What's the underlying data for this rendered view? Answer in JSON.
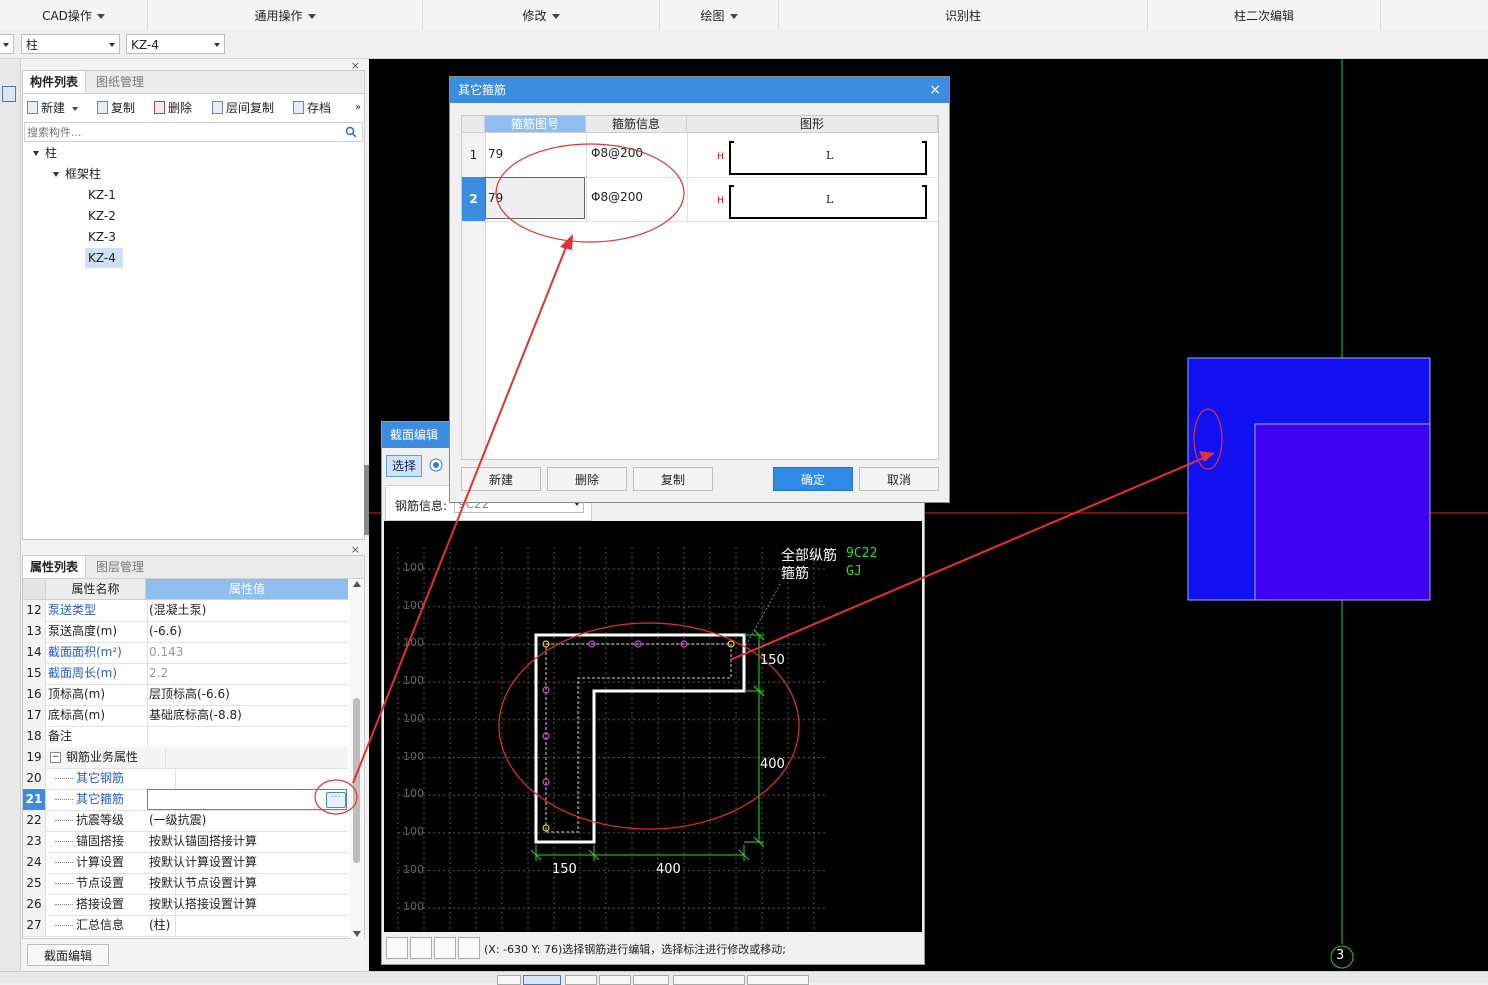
{
  "menu": {
    "items": [
      {
        "label": "CAD操作",
        "dropdown": true
      },
      {
        "label": "通用操作",
        "dropdown": true
      },
      {
        "label": "修改",
        "dropdown": true
      },
      {
        "label": "绘图",
        "dropdown": true
      },
      {
        "label": "识别柱",
        "dropdown": false
      },
      {
        "label": "柱二次编辑",
        "dropdown": false
      }
    ]
  },
  "filters": {
    "type": "柱",
    "component": "KZ-4"
  },
  "component_panel": {
    "tabs": [
      "构件列表",
      "图纸管理"
    ],
    "toolbar": [
      "新建",
      "复制",
      "删除",
      "层间复制",
      "存档"
    ],
    "search_placeholder": "搜索构件...",
    "tree": {
      "root": "柱",
      "group": "框架柱",
      "items": [
        "KZ-1",
        "KZ-2",
        "KZ-3",
        "KZ-4"
      ],
      "selected": "KZ-4"
    }
  },
  "property_panel": {
    "tabs": [
      "属性列表",
      "图层管理"
    ],
    "headers": {
      "name": "属性名称",
      "value": "属性值"
    },
    "rows": [
      {
        "num": "12",
        "name": "泵送类型",
        "value": "(混凝土泵)"
      },
      {
        "num": "13",
        "name": "泵送高度(m)",
        "value": "(-6.6)"
      },
      {
        "num": "14",
        "name": "截面面积(m²)",
        "value": "0.143"
      },
      {
        "num": "15",
        "name": "截面周长(m)",
        "value": "2.2"
      },
      {
        "num": "16",
        "name": "顶标高(m)",
        "value": "层顶标高(-6.6)"
      },
      {
        "num": "17",
        "name": "底标高(m)",
        "value": "基础底标高(-8.8)"
      },
      {
        "num": "18",
        "name": "备注",
        "value": ""
      },
      {
        "num": "19",
        "name": "钢筋业务属性",
        "value": ""
      },
      {
        "num": "20",
        "name": "其它钢筋",
        "value": ""
      },
      {
        "num": "21",
        "name": "其它箍筋",
        "value": ""
      },
      {
        "num": "22",
        "name": "抗震等级",
        "value": "(一级抗震)"
      },
      {
        "num": "23",
        "name": "锚固搭接",
        "value": "按默认锚固搭接计算"
      },
      {
        "num": "24",
        "name": "计算设置",
        "value": "按默认计算设置计算"
      },
      {
        "num": "25",
        "name": "节点设置",
        "value": "按默认节点设置计算"
      },
      {
        "num": "26",
        "name": "搭接设置",
        "value": "按默认搭接设置计算"
      },
      {
        "num": "27",
        "name": "汇总信息",
        "value": "(柱)"
      }
    ],
    "bottom_button": "截面编辑"
  },
  "dialog_stirrup": {
    "title": "其它箍筋",
    "columns": [
      "箍筋图号",
      "箍筋信息",
      "图形"
    ],
    "rows": [
      {
        "num": "1",
        "code": "79",
        "info": "Φ8@200",
        "shape_h": "H",
        "shape_l": "L"
      },
      {
        "num": "2",
        "code": "79",
        "info": "Φ8@200",
        "shape_h": "H",
        "shape_l": "L"
      }
    ],
    "buttons": {
      "new": "新建",
      "delete": "删除",
      "copy": "复制",
      "ok": "确定",
      "cancel": "取消"
    }
  },
  "dialog_section": {
    "title": "截面编辑",
    "select_button": "选择",
    "rebar_label": "钢筋信息:",
    "rebar_value": "9C22",
    "annot_all": "全部纵筋",
    "annot_all_val": "9C22",
    "annot_stirrup": "箍筋",
    "annot_stirrup_val": "GJ",
    "grid_label": "100",
    "dims": {
      "top_right": "150",
      "right": "400",
      "bottom_left": "150",
      "bottom_right": "400"
    },
    "status": "(X: -630 Y: 76)选择钢筋进行编辑，选择标注进行修改或移动;"
  },
  "canvas": {
    "axis_label": "3"
  },
  "colors": {
    "accent": "#3c8de0",
    "annotation": "#e53030",
    "column_fill": "#1010f0",
    "column_fill2": "#3d00f0"
  }
}
